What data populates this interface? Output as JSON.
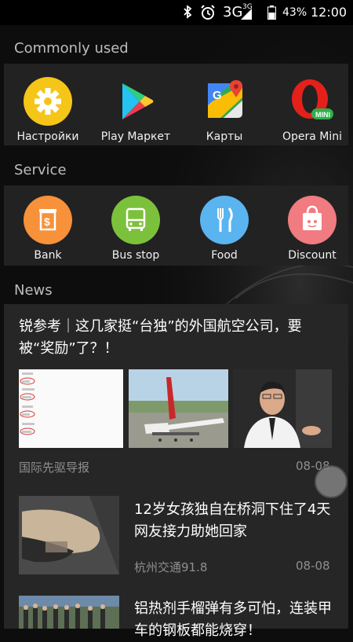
{
  "status_bar": {
    "network": "3G",
    "network_small": "3G",
    "battery": "43%",
    "time": "12:00"
  },
  "commonly_used": {
    "title": "Commonly used",
    "apps": [
      {
        "label": "Настройки",
        "icon": "settings-gear-icon"
      },
      {
        "label": "Play Маркет",
        "icon": "play-store-icon"
      },
      {
        "label": "Карты",
        "icon": "maps-icon"
      },
      {
        "label": "Opera Mini",
        "icon": "opera-mini-icon"
      }
    ]
  },
  "service": {
    "title": "Service",
    "items": [
      {
        "label": "Bank",
        "icon": "bank-icon",
        "color": "#f7913a"
      },
      {
        "label": "Bus stop",
        "icon": "bus-icon",
        "color": "#7cc13b"
      },
      {
        "label": "Food",
        "icon": "fork-knife-icon",
        "color": "#5ab4f0"
      },
      {
        "label": "Discount",
        "icon": "shopping-bag-icon",
        "color": "#f07b80"
      }
    ]
  },
  "news": {
    "title": "News",
    "items": [
      {
        "headline": "锐参考｜这几家挺“台独”的外国航空公司，要被“奖励”了？！",
        "source": "国际先驱导报",
        "date": "08-08"
      },
      {
        "headline": "12岁女孩独自在桥洞下住了4天 网友接力助她回家",
        "source": "杭州交通91.8",
        "date": "08-08"
      },
      {
        "headline": "铝热剂手榴弹有多可怕，连装甲车的钢板都能烧穿！",
        "source": "",
        "date": ""
      }
    ]
  }
}
